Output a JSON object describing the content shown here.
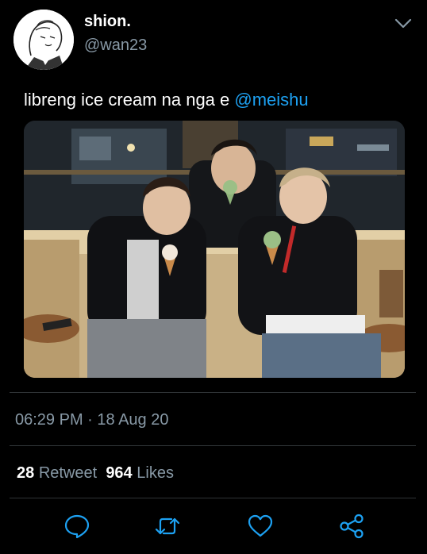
{
  "user": {
    "display_name": "shion.",
    "handle": "@wan23",
    "avatar_icon": "sketch-avatar"
  },
  "tweet": {
    "text": "libreng ice cream na nga e ",
    "mention": "@meishu",
    "media_description": "photo",
    "time": "06:29 PM",
    "separator": " · ",
    "date": "18 Aug 20"
  },
  "stats": {
    "retweets_count": "28",
    "retweets_label": "Retweet",
    "likes_count": "964",
    "likes_label": "Likes"
  },
  "actions": [
    {
      "name": "reply",
      "icon": "speech-bubble-icon"
    },
    {
      "name": "retweet",
      "icon": "retweet-arrows-icon"
    },
    {
      "name": "like",
      "icon": "heart-icon"
    },
    {
      "name": "share",
      "icon": "share-icon"
    }
  ],
  "colors": {
    "background": "#000000",
    "text": "#ffffff",
    "secondary": "#8899a6",
    "accent": "#1da1f2",
    "divider": "#2f3336"
  }
}
